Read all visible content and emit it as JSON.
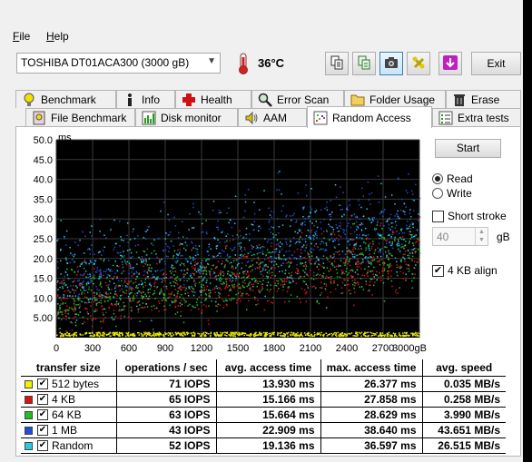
{
  "menu": {
    "file_u": "F",
    "file_rest": "ile",
    "help_u": "H",
    "help_rest": "elp"
  },
  "toolbar": {
    "drive": "TOSHIBA DT01ACA300 (3000 gB)",
    "temperature": "36°C",
    "exit_label": "Exit",
    "icons": [
      "copy-info-icon",
      "copy-text-icon",
      "screenshot-camera-icon",
      "options-icon",
      "save-arrow-icon"
    ]
  },
  "tabs_row1": [
    {
      "label": "Benchmark",
      "icon": "bulb-icon"
    },
    {
      "label": "Info",
      "icon": "info-icon"
    },
    {
      "label": "Health",
      "icon": "health-cross-icon"
    },
    {
      "label": "Error Scan",
      "icon": "magnifier-icon"
    },
    {
      "label": "Folder Usage",
      "icon": "folder-icon"
    },
    {
      "label": "Erase",
      "icon": "trash-icon"
    }
  ],
  "tabs_row2": [
    {
      "label": "File Benchmark",
      "icon": "file-bulb-icon"
    },
    {
      "label": "Disk monitor",
      "icon": "bar-chart-icon"
    },
    {
      "label": "AAM",
      "icon": "speaker-icon"
    },
    {
      "label": "Random Access",
      "icon": "dots-icon",
      "active": true
    },
    {
      "label": "Extra tests",
      "icon": "list-icon"
    }
  ],
  "controls": {
    "start_label": "Start",
    "read_label": "Read",
    "write_label": "Write",
    "read_selected": true,
    "short_stroke_label": "Short stroke",
    "short_stroke_checked": false,
    "stroke_value": "40",
    "stroke_unit": "gB",
    "align_label": "4 KB align",
    "align_checked": true
  },
  "chart_data": {
    "type": "scatter",
    "ylabel": "ms",
    "xlabel": "",
    "x_unit": "gB",
    "y_ticks": [
      "50.0",
      "45.0",
      "40.0",
      "35.0",
      "30.0",
      "25.0",
      "20.0",
      "15.0",
      "10.0",
      "5.00"
    ],
    "x_ticks": [
      "0",
      "300",
      "600",
      "900",
      "1200",
      "1500",
      "1800",
      "2100",
      "2400",
      "2700",
      "3000gB"
    ],
    "xlim": [
      0,
      3000
    ],
    "ylim": [
      0,
      50
    ],
    "grid": true,
    "series": [
      {
        "name": "512 bytes",
        "color": "#e8e800",
        "trend": [
          [
            0,
            12.5
          ],
          [
            3000,
            15.5
          ]
        ],
        "spread": 4,
        "band": [
          0.5,
          1.5
        ]
      },
      {
        "name": "4 KB",
        "color": "#e01010",
        "trend": [
          [
            0,
            8
          ],
          [
            3000,
            20
          ]
        ],
        "spread": 5
      },
      {
        "name": "64 KB",
        "color": "#20c020",
        "trend": [
          [
            0,
            9
          ],
          [
            3000,
            21
          ]
        ],
        "spread": 5
      },
      {
        "name": "1 MB",
        "color": "#2050d0",
        "trend": [
          [
            0,
            15
          ],
          [
            3000,
            30
          ]
        ],
        "spread": 6
      },
      {
        "name": "Random",
        "color": "#30c8e0",
        "trend": [
          [
            0,
            13
          ],
          [
            3000,
            26
          ]
        ],
        "spread": 7
      }
    ]
  },
  "results": {
    "headers": [
      "transfer size",
      "operations / sec",
      "avg. access time",
      "max. access time",
      "avg. speed"
    ],
    "rows": [
      {
        "label": "512 bytes",
        "color": "#f2f200",
        "ops": "71 IOPS",
        "avg": "13.930 ms",
        "max": "26.377 ms",
        "speed": "0.035 MB/s"
      },
      {
        "label": "4 KB",
        "color": "#e01010",
        "ops": "65 IOPS",
        "avg": "15.166 ms",
        "max": "27.858 ms",
        "speed": "0.258 MB/s"
      },
      {
        "label": "64 KB",
        "color": "#20c020",
        "ops": "63 IOPS",
        "avg": "15.664 ms",
        "max": "28.629 ms",
        "speed": "3.990 MB/s"
      },
      {
        "label": "1 MB",
        "color": "#2050d0",
        "ops": "43 IOPS",
        "avg": "22.909 ms",
        "max": "38.640 ms",
        "speed": "43.651 MB/s"
      },
      {
        "label": "Random",
        "color": "#30c8e0",
        "ops": "52 IOPS",
        "avg": "19.136 ms",
        "max": "36.597 ms",
        "speed": "26.515 MB/s"
      }
    ]
  }
}
